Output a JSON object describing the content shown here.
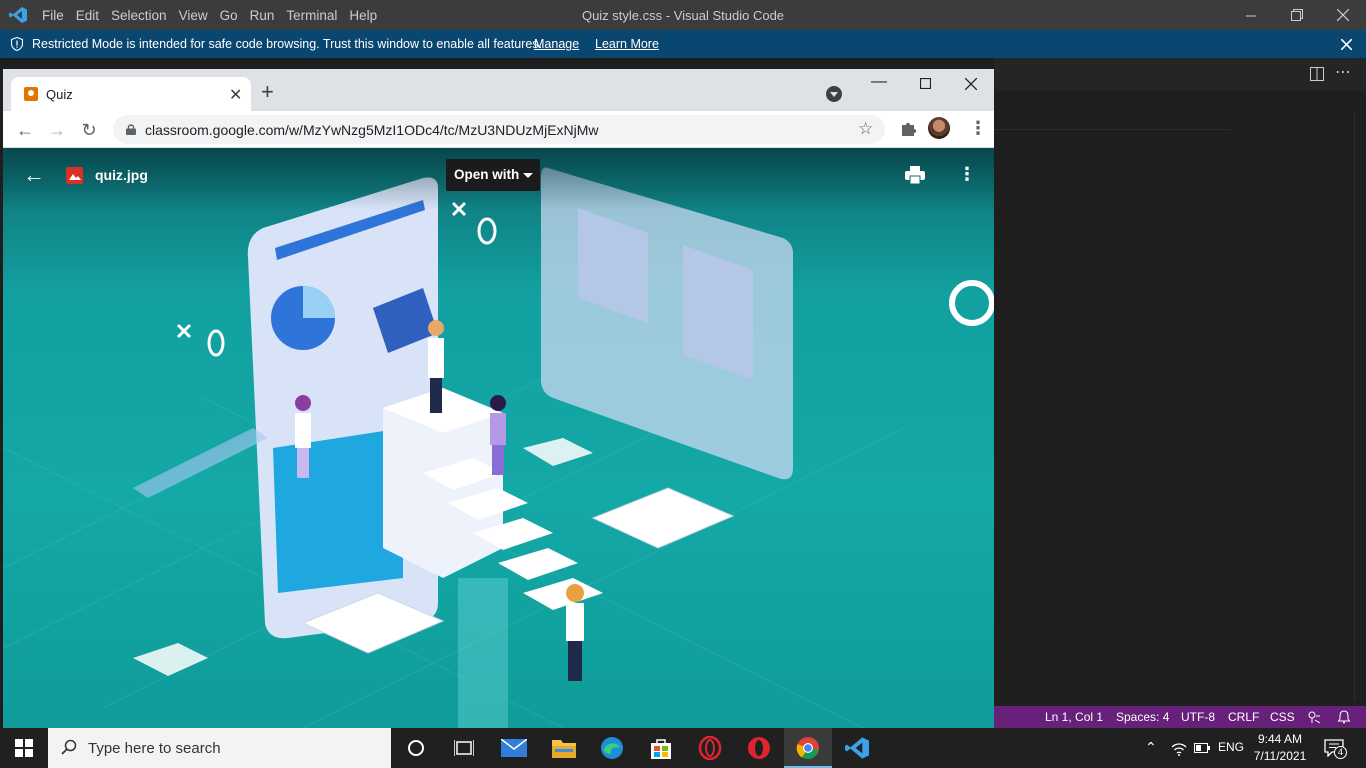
{
  "vscode": {
    "menu": [
      "File",
      "Edit",
      "Selection",
      "View",
      "Go",
      "Run",
      "Terminal",
      "Help"
    ],
    "window_title": "Quiz style.css - Visual Studio Code",
    "banner": {
      "message": "Restricted Mode is intended for safe code browsing. Trust this window to enable all features.",
      "manage": "Manage",
      "learn_more": "Learn More"
    },
    "status": {
      "position": "Ln 1, Col 1",
      "spaces": "Spaces: 4",
      "encoding": "UTF-8",
      "eol": "CRLF",
      "language": "CSS"
    },
    "colors": {
      "titlebar": "#3c3c3c",
      "banner": "#094771",
      "statusbar": "#68217a",
      "editor": "#1e1e1e"
    }
  },
  "chrome": {
    "tab_title": "Quiz",
    "url": "classroom.google.com/w/MzYwNzg5MzI1ODc4/tc/MzU3NDUzMjExNjMw",
    "viewer": {
      "file_name": "quiz.jpg",
      "open_with": "Open with"
    }
  },
  "taskbar": {
    "search_placeholder": "Type here to search",
    "language": "ENG",
    "time": "9:44 AM",
    "date": "7/11/2021",
    "notification_count": "4",
    "apps": [
      "cortana",
      "task-view",
      "mail",
      "file-explorer",
      "edge",
      "store",
      "opera",
      "opera-gx",
      "chrome",
      "vscode"
    ]
  }
}
